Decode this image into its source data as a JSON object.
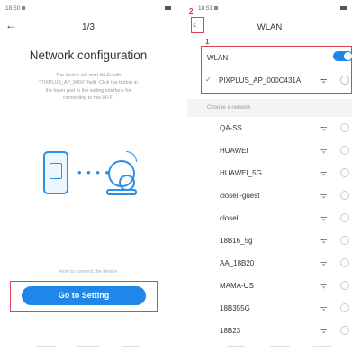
{
  "left": {
    "status": {
      "time": "18:50"
    },
    "header": {
      "back_glyph": "←",
      "page_indicator": "1/3"
    },
    "title": "Network configuration",
    "description": "The device will start Wi-Fi with \"PIXPLUS_AP_000X\" field. Click the button in the lower part to the setting interface for connecting to this Wi-Fi",
    "how_to": "How to connect the device",
    "button": "Go to Setting",
    "illustration": {
      "phone_icon": "phone-icon",
      "camera_icon": "camera-icon"
    }
  },
  "right": {
    "status": {
      "time": "18:51"
    },
    "header": {
      "back_glyph": "‹",
      "title": "WLAN"
    },
    "markers": {
      "back": "2",
      "wlan": "1"
    },
    "wlan": {
      "label": "WLAN",
      "enabled": true
    },
    "connected": {
      "check": "✓",
      "ssid": "PIXPLUS_AP_000C431A"
    },
    "choose_label": "Choose a network",
    "networks": [
      {
        "ssid": "QA-SS"
      },
      {
        "ssid": "HUAWEI"
      },
      {
        "ssid": "HUAWEI_5G"
      },
      {
        "ssid": "closeli-guest"
      },
      {
        "ssid": "closeli"
      },
      {
        "ssid": "18B16_5g"
      },
      {
        "ssid": "AA_18B20"
      },
      {
        "ssid": "MAMA-US"
      },
      {
        "ssid": "18B355G"
      },
      {
        "ssid": "18B23"
      }
    ]
  },
  "colors": {
    "accent": "#1f87ea",
    "highlight": "#d9465a",
    "marker": "#e03030"
  }
}
